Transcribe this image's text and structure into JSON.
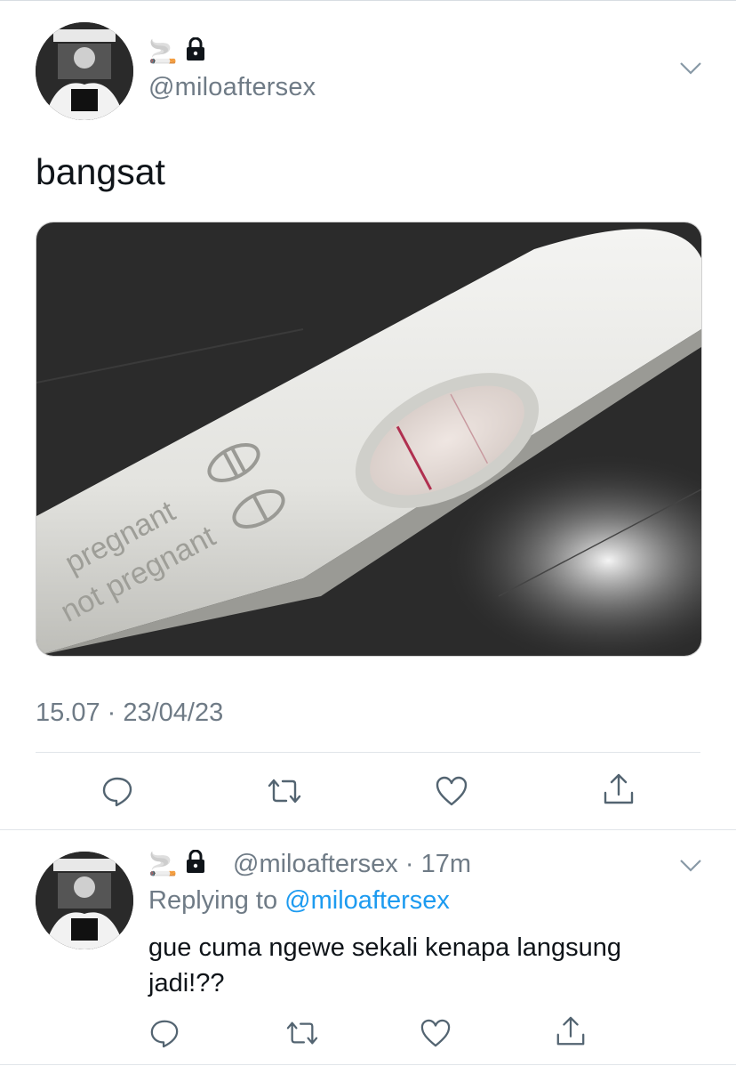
{
  "tweet": {
    "display_name_emoji": "🚬",
    "handle": "@miloaftersex",
    "text": "bangsat",
    "image_labels": {
      "pregnant": "pregnant",
      "not_pregnant": "not pregnant"
    },
    "timestamp": "15.07 · 23/04/23",
    "icons": [
      "reply-icon",
      "retweet-icon",
      "like-icon",
      "share-icon"
    ]
  },
  "reply": {
    "display_name_emoji": "🚬",
    "handle": "@miloaftersex",
    "time": "17m",
    "replying_prefix": "Replying to ",
    "replying_handle": "@miloaftersex",
    "text": "gue cuma ngewe sekali kenapa langsung jadi!??",
    "icons": [
      "reply-icon",
      "retweet-icon",
      "like-icon",
      "share-icon"
    ]
  },
  "colors": {
    "text": "#0f1419",
    "muted": "#6f7b86",
    "link": "#1d9bf0",
    "divider": "#e1e5e9"
  }
}
